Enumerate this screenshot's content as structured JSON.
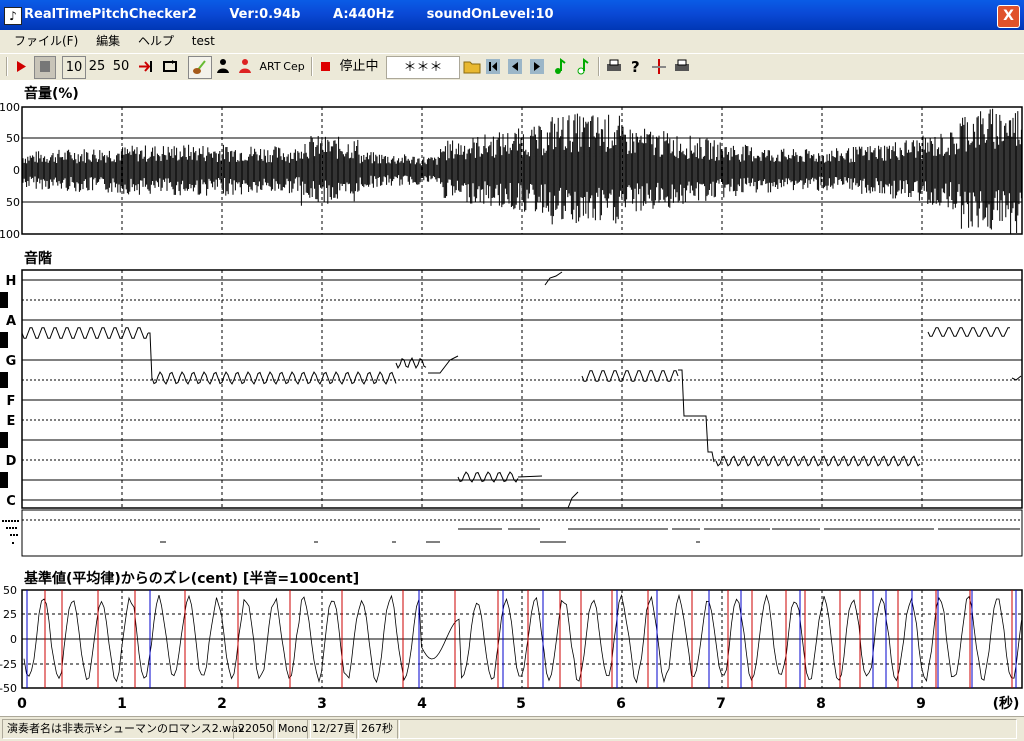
{
  "title_bar": {
    "app_name": "RealTimePitchChecker2",
    "version": "Ver:0.94b",
    "a_freq": "A:440Hz",
    "sound_on_level": "soundOnLevel:10",
    "close_glyph": "X",
    "app_icon": "metronome-icon"
  },
  "menu": [
    "ファイル(F)",
    "編集",
    "ヘルプ",
    "test"
  ],
  "toolbar": {
    "speed_10": "10",
    "speed_25": "25",
    "speed_50": "50",
    "art": "ART",
    "cep": "Cep",
    "status": "停止中",
    "display": "＊＊＊"
  },
  "panels": {
    "volume": {
      "title": "音量(%)",
      "y_labels": [
        "100",
        "50",
        "0",
        "50",
        "100"
      ]
    },
    "scale": {
      "title": "音階",
      "notes": [
        "H",
        "A",
        "G",
        "F",
        "E",
        "D",
        "C"
      ]
    },
    "deviation": {
      "title": "基準値(平均律)からのズレ(cent) [半音=100cent]",
      "y_labels": [
        "50",
        "25",
        "0",
        "-25",
        "-50"
      ]
    }
  },
  "x_axis": {
    "labels": [
      "0",
      "1",
      "2",
      "3",
      "4",
      "5",
      "6",
      "7",
      "8",
      "9"
    ],
    "unit": "(秒)"
  },
  "status": [
    "演奏者名は非表示¥シューマンのロマンス2.wav",
    "22050",
    "Mono",
    "12/27頁",
    "267秒"
  ],
  "colors": {
    "titlebar": "#0A49D6",
    "grid": "#000000",
    "red_line": "#CC0000",
    "blue_line": "#0000CC"
  }
}
